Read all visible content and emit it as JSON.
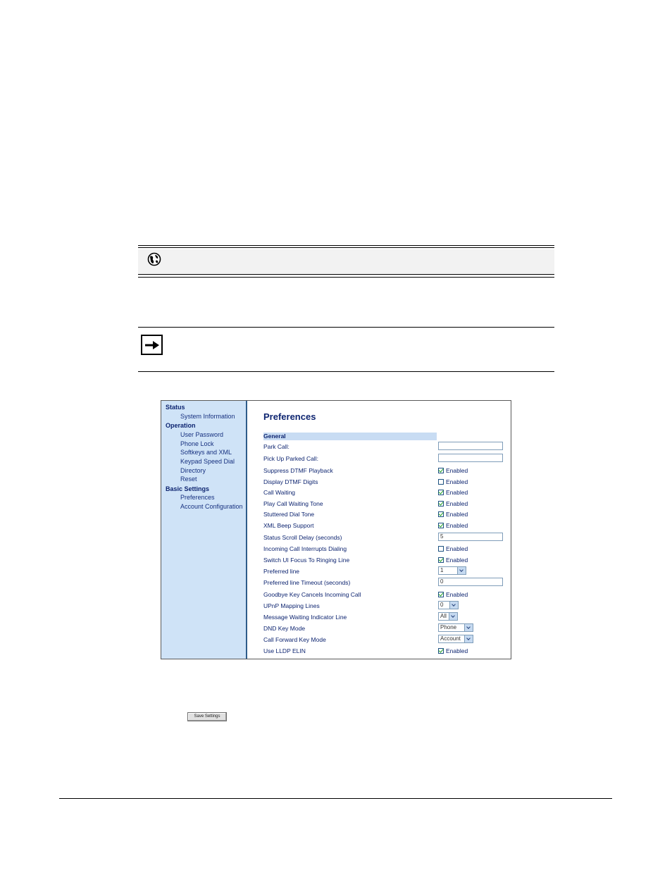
{
  "sidebar": {
    "items": [
      {
        "label": "Status",
        "head": true
      },
      {
        "label": "System Information",
        "head": false
      },
      {
        "label": "Operation",
        "head": true
      },
      {
        "label": "User Password",
        "head": false
      },
      {
        "label": "Phone Lock",
        "head": false
      },
      {
        "label": "Softkeys and XML",
        "head": false
      },
      {
        "label": "Keypad Speed Dial",
        "head": false
      },
      {
        "label": "Directory",
        "head": false
      },
      {
        "label": "Reset",
        "head": false
      },
      {
        "label": "Basic Settings",
        "head": true
      },
      {
        "label": "Preferences",
        "head": false
      },
      {
        "label": "Account Configuration",
        "head": false
      }
    ]
  },
  "main": {
    "title": "Preferences",
    "section": "General",
    "rows": [
      {
        "label": "Park Call:",
        "type": "text",
        "value": ""
      },
      {
        "label": "Pick Up Parked Call:",
        "type": "text",
        "value": ""
      },
      {
        "label": "Suppress DTMF Playback",
        "type": "checkbox",
        "checked": true,
        "text": "Enabled"
      },
      {
        "label": "Display DTMF Digits",
        "type": "checkbox",
        "checked": false,
        "text": "Enabled"
      },
      {
        "label": "Call Waiting",
        "type": "checkbox",
        "checked": true,
        "text": "Enabled"
      },
      {
        "label": "Play Call Waiting Tone",
        "type": "checkbox",
        "checked": true,
        "text": "Enabled"
      },
      {
        "label": "Stuttered Dial Tone",
        "type": "checkbox",
        "checked": true,
        "text": "Enabled"
      },
      {
        "label": "XML Beep Support",
        "type": "checkbox",
        "checked": true,
        "text": "Enabled"
      },
      {
        "label": "Status Scroll Delay (seconds)",
        "type": "text",
        "value": "5"
      },
      {
        "label": "Incoming Call Interrupts Dialing",
        "type": "checkbox",
        "checked": false,
        "text": "Enabled"
      },
      {
        "label": "Switch UI Focus To Ringing Line",
        "type": "checkbox",
        "checked": true,
        "text": "Enabled"
      },
      {
        "label": "Preferred line",
        "type": "select",
        "value": "1"
      },
      {
        "label": "Preferred line Timeout (seconds)",
        "type": "text",
        "value": "0"
      },
      {
        "label": "Goodbye Key Cancels Incoming Call",
        "type": "checkbox",
        "checked": true,
        "text": "Enabled"
      },
      {
        "label": "UPnP Mapping Lines",
        "type": "select",
        "value": "0"
      },
      {
        "label": "Message Waiting Indicator Line",
        "type": "select",
        "value": "All"
      },
      {
        "label": "DND Key Mode",
        "type": "select",
        "value": "Phone"
      },
      {
        "label": "Call Forward Key Mode",
        "type": "select",
        "value": "Account"
      },
      {
        "label": "Use LLDP ELIN",
        "type": "checkbox",
        "checked": true,
        "text": "Enabled"
      }
    ]
  },
  "save_button": {
    "label": "Save Settings"
  },
  "icons": {
    "web_note": "globe-phone-icon",
    "note": "arrow-right-icon"
  },
  "colors": {
    "sidebar_bg": "#cfe3f7",
    "accent": "#0d2470",
    "section_bg": "#c8dcf3"
  }
}
